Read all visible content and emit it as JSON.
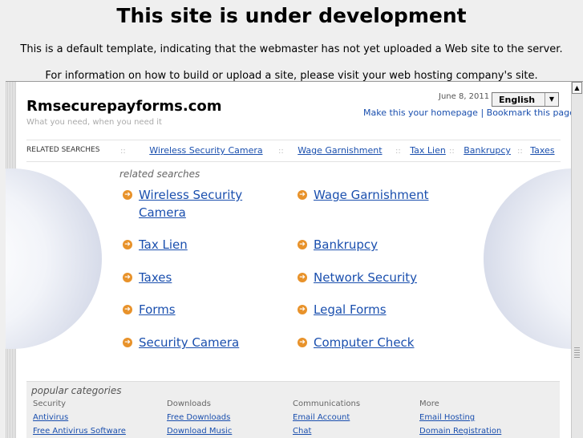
{
  "header": {
    "title": "This site is under development",
    "line1": "This is a default template, indicating that the webmaster has not yet uploaded a Web site to the server.",
    "line2": "For information on how to build or upload a site, please visit your web hosting company's site."
  },
  "site": {
    "name": "Rmsecurepayforms.com",
    "tagline": "What you need, when you need it",
    "date": "June 8, 2011",
    "language": "English",
    "make_homepage": "Make this your homepage",
    "separator": "|",
    "bookmark": "Bookmark this page"
  },
  "related_bar": {
    "label": "RELATED SEARCHES",
    "dots": "::",
    "items": [
      "Wireless Security Camera",
      "Wage Garnishment",
      "Tax Lien",
      "Bankrupcy",
      "Taxes"
    ]
  },
  "related": {
    "title": "related searches",
    "left": [
      "Wireless Security Camera",
      "Tax Lien",
      "Taxes",
      "Forms",
      "Security Camera"
    ],
    "right": [
      "Wage Garnishment",
      "Bankrupcy",
      "Network Security",
      "Legal Forms",
      "Computer Check"
    ]
  },
  "popular": {
    "title": "popular categories",
    "columns": [
      {
        "heading": "Security",
        "links": [
          "Antivirus",
          "Free Antivirus Software"
        ]
      },
      {
        "heading": "Downloads",
        "links": [
          "Free Downloads",
          "Download Music"
        ]
      },
      {
        "heading": "Communications",
        "links": [
          "Email Account",
          "Chat"
        ]
      },
      {
        "heading": "More",
        "links": [
          "Email Hosting",
          "Domain Registration"
        ]
      }
    ]
  },
  "icons": {
    "bullet": "arrow-right-circle-icon",
    "scroll_up": "scroll-up-arrow-icon",
    "dropdown": "chevron-down-icon"
  },
  "colors": {
    "link": "#1a4fae",
    "bullet": "#e8922a",
    "background": "#efefef"
  }
}
